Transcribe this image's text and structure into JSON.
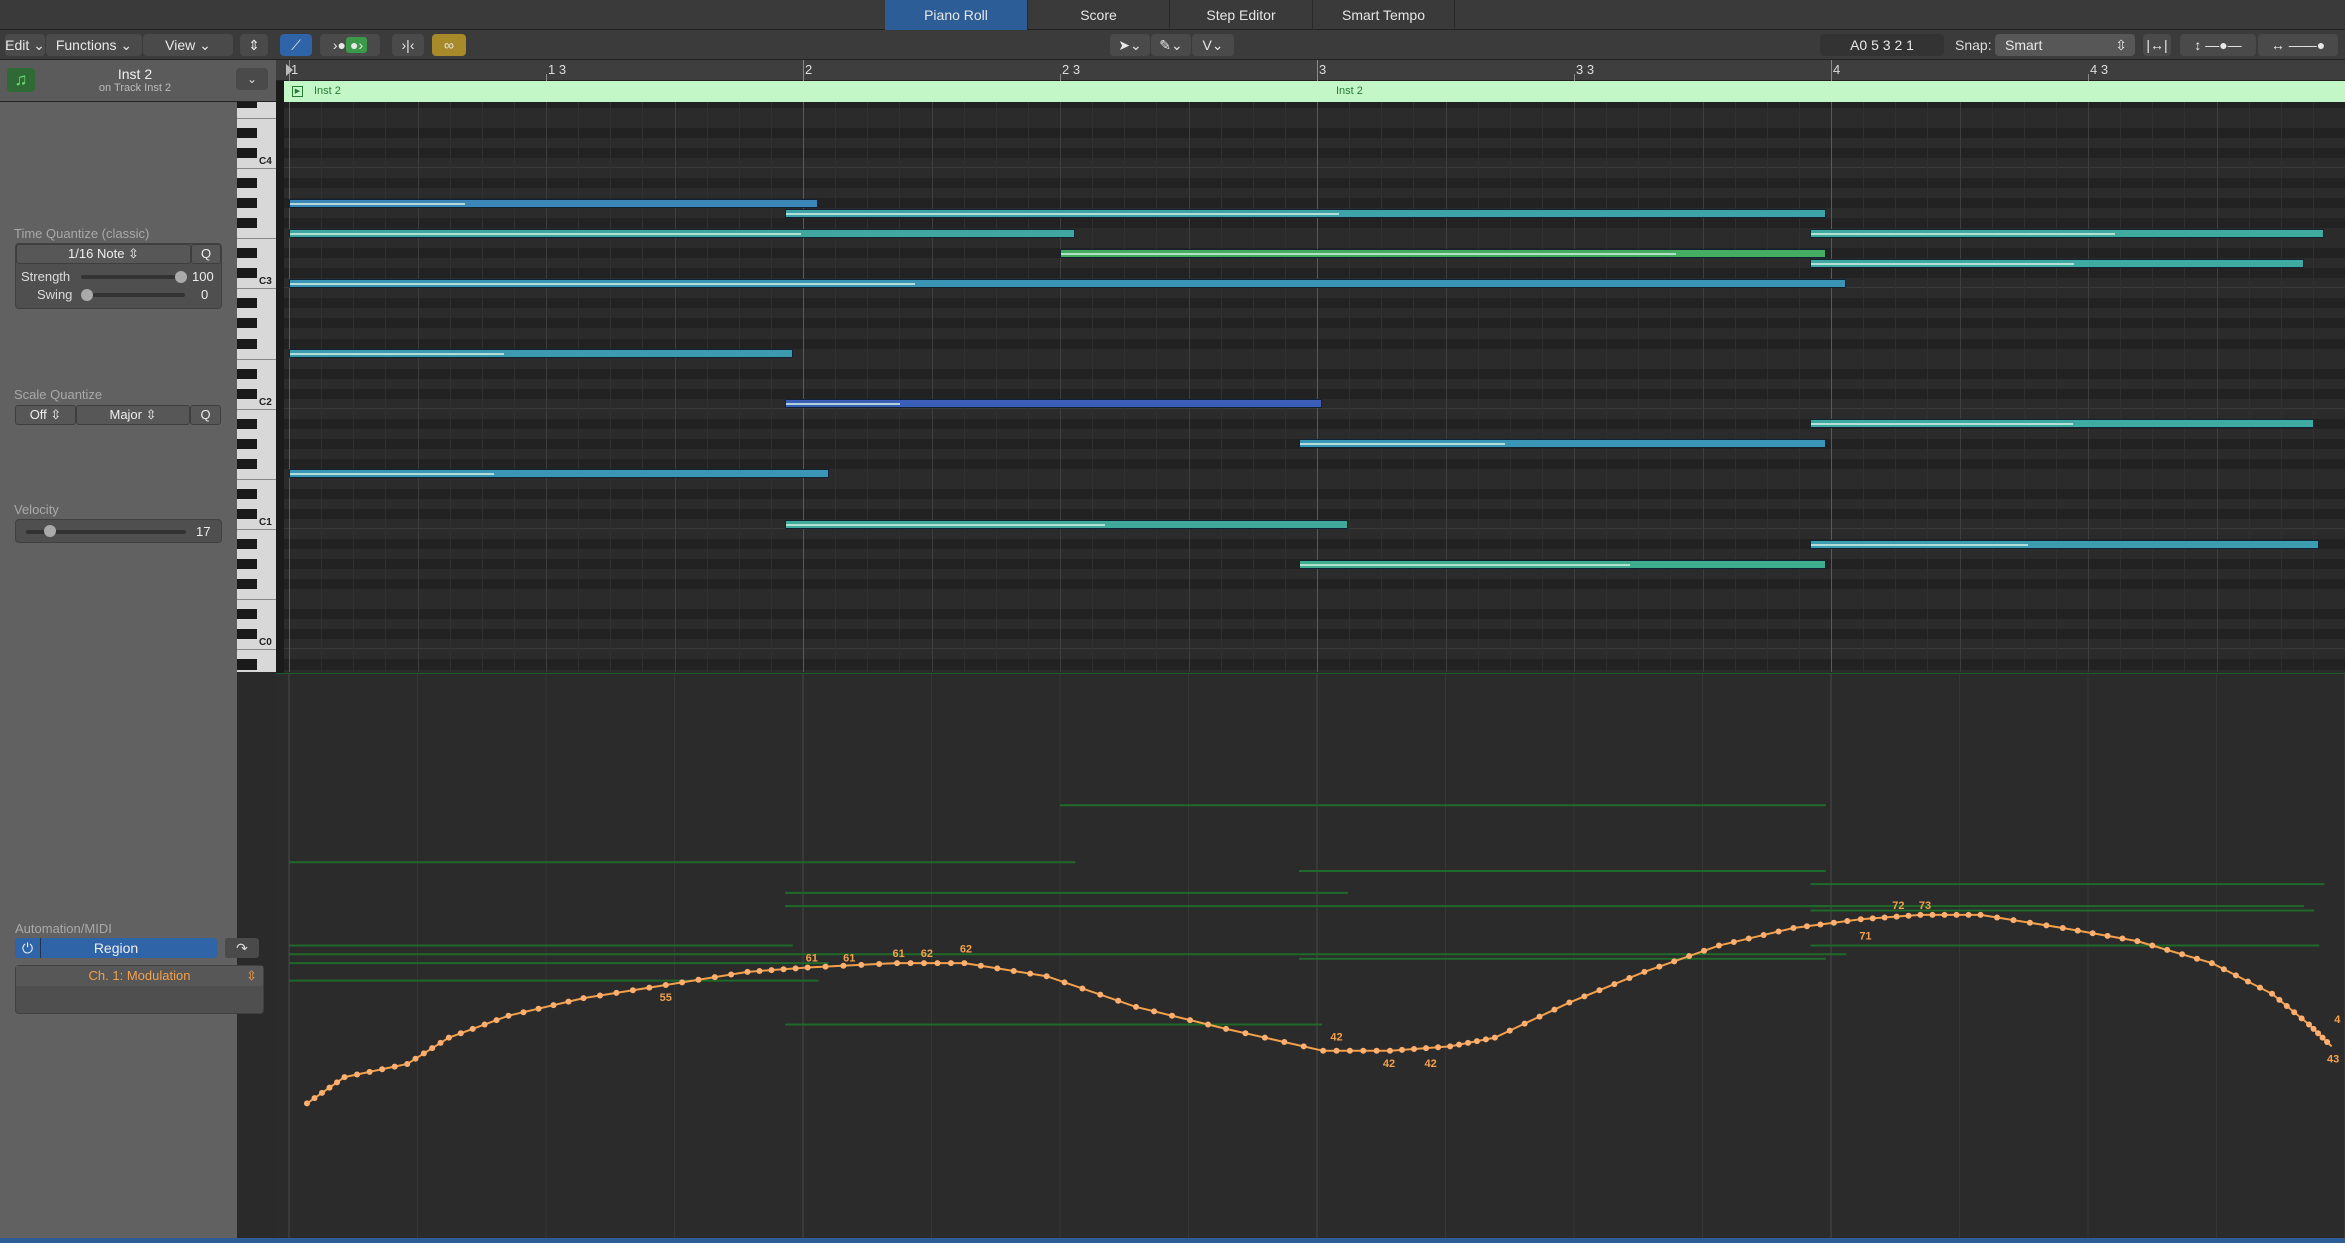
{
  "tabs": [
    {
      "label": "Piano Roll",
      "active": true
    },
    {
      "label": "Score",
      "active": false
    },
    {
      "label": "Step Editor",
      "active": false
    },
    {
      "label": "Smart Tempo",
      "active": false
    }
  ],
  "toolbar": {
    "edit": "Edit",
    "functions": "Functions",
    "view": "View",
    "position": "A0  5 3 2 1",
    "snap_label": "Snap:",
    "snap_value": "Smart"
  },
  "inspector": {
    "region_name": "Inst 2",
    "track_name": "on Track Inst 2",
    "time_quantize": {
      "label": "Time Quantize (classic)",
      "value": "1/16 Note",
      "q": "Q",
      "strength_label": "Strength",
      "strength": 100,
      "swing_label": "Swing",
      "swing": 0
    },
    "scale_quantize": {
      "label": "Scale Quantize",
      "mode": "Off",
      "scale": "Major",
      "q": "Q"
    },
    "velocity": {
      "label": "Velocity",
      "value": 17
    },
    "automation": {
      "label": "Automation/MIDI",
      "mode": "Region",
      "parameter": "Ch. 1: Modulation"
    }
  },
  "keyboard_labels": [
    {
      "name": "C4",
      "pitch": 60
    },
    {
      "name": "C3",
      "pitch": 48
    },
    {
      "name": "C2",
      "pitch": 36
    },
    {
      "name": "C1",
      "pitch": 24
    },
    {
      "name": "C0",
      "pitch": 12
    }
  ],
  "ruler": [
    {
      "label": "1",
      "bar": 1
    },
    {
      "label": "1 3",
      "bar": 1.5
    },
    {
      "label": "2",
      "bar": 2
    },
    {
      "label": "2 3",
      "bar": 2.5
    },
    {
      "label": "3",
      "bar": 3
    },
    {
      "label": "3 3",
      "bar": 3.5
    },
    {
      "label": "4",
      "bar": 4
    },
    {
      "label": "4 3",
      "bar": 4.5
    }
  ],
  "region": {
    "name": "Inst 2",
    "name_repeat": "Inst 2"
  },
  "notes": [
    {
      "pitch": 56,
      "start": 1.0,
      "end": 2.03,
      "velocity": 28,
      "color": "#3d86b8"
    },
    {
      "pitch": 55,
      "start": 1.965,
      "end": 3.99,
      "velocity": 45,
      "color": "#3da3a8"
    },
    {
      "pitch": 53,
      "start": 1.0,
      "end": 2.53,
      "velocity": 55,
      "color": "#3fa7a0"
    },
    {
      "pitch": 53,
      "start": 3.96,
      "end": 4.96,
      "velocity": 50,
      "color": "#3faa9e"
    },
    {
      "pitch": 51,
      "start": 2.5,
      "end": 3.99,
      "velocity": 68,
      "color": "#44ad62"
    },
    {
      "pitch": 50,
      "start": 3.96,
      "end": 4.92,
      "velocity": 45,
      "color": "#3faaa2"
    },
    {
      "pitch": 48,
      "start": 1.0,
      "end": 4.03,
      "velocity": 34,
      "color": "#3a95b5"
    },
    {
      "pitch": 41,
      "start": 1.0,
      "end": 1.98,
      "velocity": 36,
      "color": "#3d9bb0"
    },
    {
      "pitch": 36,
      "start": 1.965,
      "end": 3.01,
      "velocity": 18,
      "color": "#3b5fb8"
    },
    {
      "pitch": 34,
      "start": 3.96,
      "end": 4.94,
      "velocity": 44,
      "color": "#3faaa2"
    },
    {
      "pitch": 32,
      "start": 2.965,
      "end": 3.99,
      "velocity": 33,
      "color": "#3b95b4"
    },
    {
      "pitch": 29,
      "start": 1.0,
      "end": 2.05,
      "velocity": 32,
      "color": "#3b95b4"
    },
    {
      "pitch": 24,
      "start": 1.965,
      "end": 3.06,
      "velocity": 48,
      "color": "#3faa9a"
    },
    {
      "pitch": 22,
      "start": 3.96,
      "end": 4.95,
      "velocity": 36,
      "color": "#3c9db0"
    },
    {
      "pitch": 20,
      "start": 2.965,
      "end": 3.99,
      "velocity": 53,
      "color": "#3fae8e"
    }
  ],
  "automation_curve": {
    "range": [
      0,
      127
    ],
    "color": "#f4a04a",
    "points": [
      [
        1.035,
        30
      ],
      [
        1.108,
        36
      ],
      [
        1.23,
        39
      ],
      [
        1.311,
        45
      ],
      [
        1.427,
        50
      ],
      [
        1.573,
        54
      ],
      [
        1.733,
        57
      ],
      [
        1.892,
        60
      ],
      [
        2.009,
        61
      ],
      [
        2.183,
        62
      ],
      [
        2.314,
        62
      ],
      [
        2.474,
        59
      ],
      [
        2.648,
        52
      ],
      [
        2.823,
        47
      ],
      [
        3.012,
        42
      ],
      [
        3.142,
        42
      ],
      [
        3.259,
        43
      ],
      [
        3.346,
        45
      ],
      [
        3.491,
        53
      ],
      [
        3.637,
        60
      ],
      [
        3.782,
        66
      ],
      [
        3.927,
        70
      ],
      [
        4.058,
        72
      ],
      [
        4.174,
        73
      ],
      [
        4.291,
        73
      ],
      [
        4.451,
        70
      ],
      [
        4.596,
        67
      ],
      [
        4.741,
        62
      ],
      [
        4.858,
        55
      ],
      [
        4.93,
        48
      ],
      [
        4.974,
        43
      ]
    ],
    "labels": [
      {
        "text": "55",
        "bar": 1.733,
        "value": 57,
        "below": true
      },
      {
        "text": "61",
        "bar": 2.017,
        "value": 61
      },
      {
        "text": "61",
        "bar": 2.09,
        "value": 61
      },
      {
        "text": "61",
        "bar": 2.186,
        "value": 62
      },
      {
        "text": "62",
        "bar": 2.241,
        "value": 62
      },
      {
        "text": "62",
        "bar": 2.317,
        "value": 63
      },
      {
        "text": "42",
        "bar": 3.038,
        "value": 43
      },
      {
        "text": "42",
        "bar": 3.14,
        "value": 42,
        "below": true
      },
      {
        "text": "42",
        "bar": 3.221,
        "value": 42,
        "below": true
      },
      {
        "text": "71",
        "bar": 4.067,
        "value": 71,
        "below": true
      },
      {
        "text": "72",
        "bar": 4.131,
        "value": 73
      },
      {
        "text": "73",
        "bar": 4.183,
        "value": 73
      },
      {
        "text": "43",
        "bar": 4.977,
        "value": 43,
        "below": true
      },
      {
        "text": "4",
        "bar": 4.985,
        "value": 47
      }
    ]
  }
}
